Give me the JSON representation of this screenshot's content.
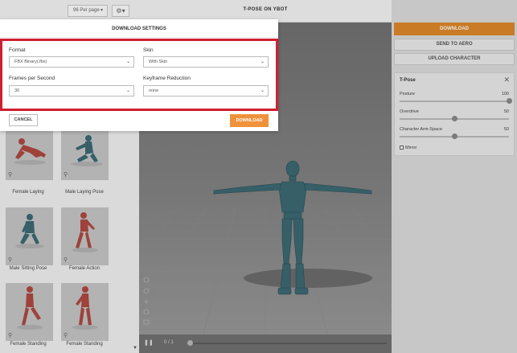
{
  "library": {
    "per_page": "96 Per page",
    "items": [
      {
        "label": "Female Laying"
      },
      {
        "label": "Male Laying Pose"
      },
      {
        "label": "Male Sitting Pose"
      },
      {
        "label": "Female Action"
      },
      {
        "label": "Female Standing"
      },
      {
        "label": "Female Standing"
      }
    ]
  },
  "viewport": {
    "title": "T-POSE ON YBOT",
    "frame_counter": "0 / 1",
    "timeline_position": 0
  },
  "actions": {
    "download": "DOWNLOAD",
    "send_to_aero": "SEND TO AERO",
    "upload_character": "UPLOAD CHARACTER"
  },
  "pose_panel": {
    "title": "T-Pose",
    "sliders": [
      {
        "label": "Posture",
        "value": "100",
        "level": 1.0
      },
      {
        "label": "Overdrive",
        "value": "50",
        "level": 0.5
      },
      {
        "label": "Character Arm-Space",
        "value": "50",
        "level": 0.5
      }
    ],
    "mirror_label": "Mirror",
    "mirror_checked": false
  },
  "modal": {
    "title": "DOWNLOAD SETTINGS",
    "format_label": "Format",
    "format_value": "FBX Binary(.fbx)",
    "skin_label": "Skin",
    "skin_value": "With Skin",
    "fps_label": "Frames per Second",
    "fps_value": "30",
    "keyframe_label": "Keyframe Reduction",
    "keyframe_value": "none",
    "cancel_label": "CANCEL",
    "download_label": "DOWNLOAD"
  },
  "colors": {
    "accent_orange": "#f0923a",
    "download_orange": "#e08a2a",
    "highlight_red": "#d01f2f",
    "figure_red": "#b04a42",
    "figure_teal": "#3d6a74",
    "viewport_bg": "#7d7d7d"
  }
}
